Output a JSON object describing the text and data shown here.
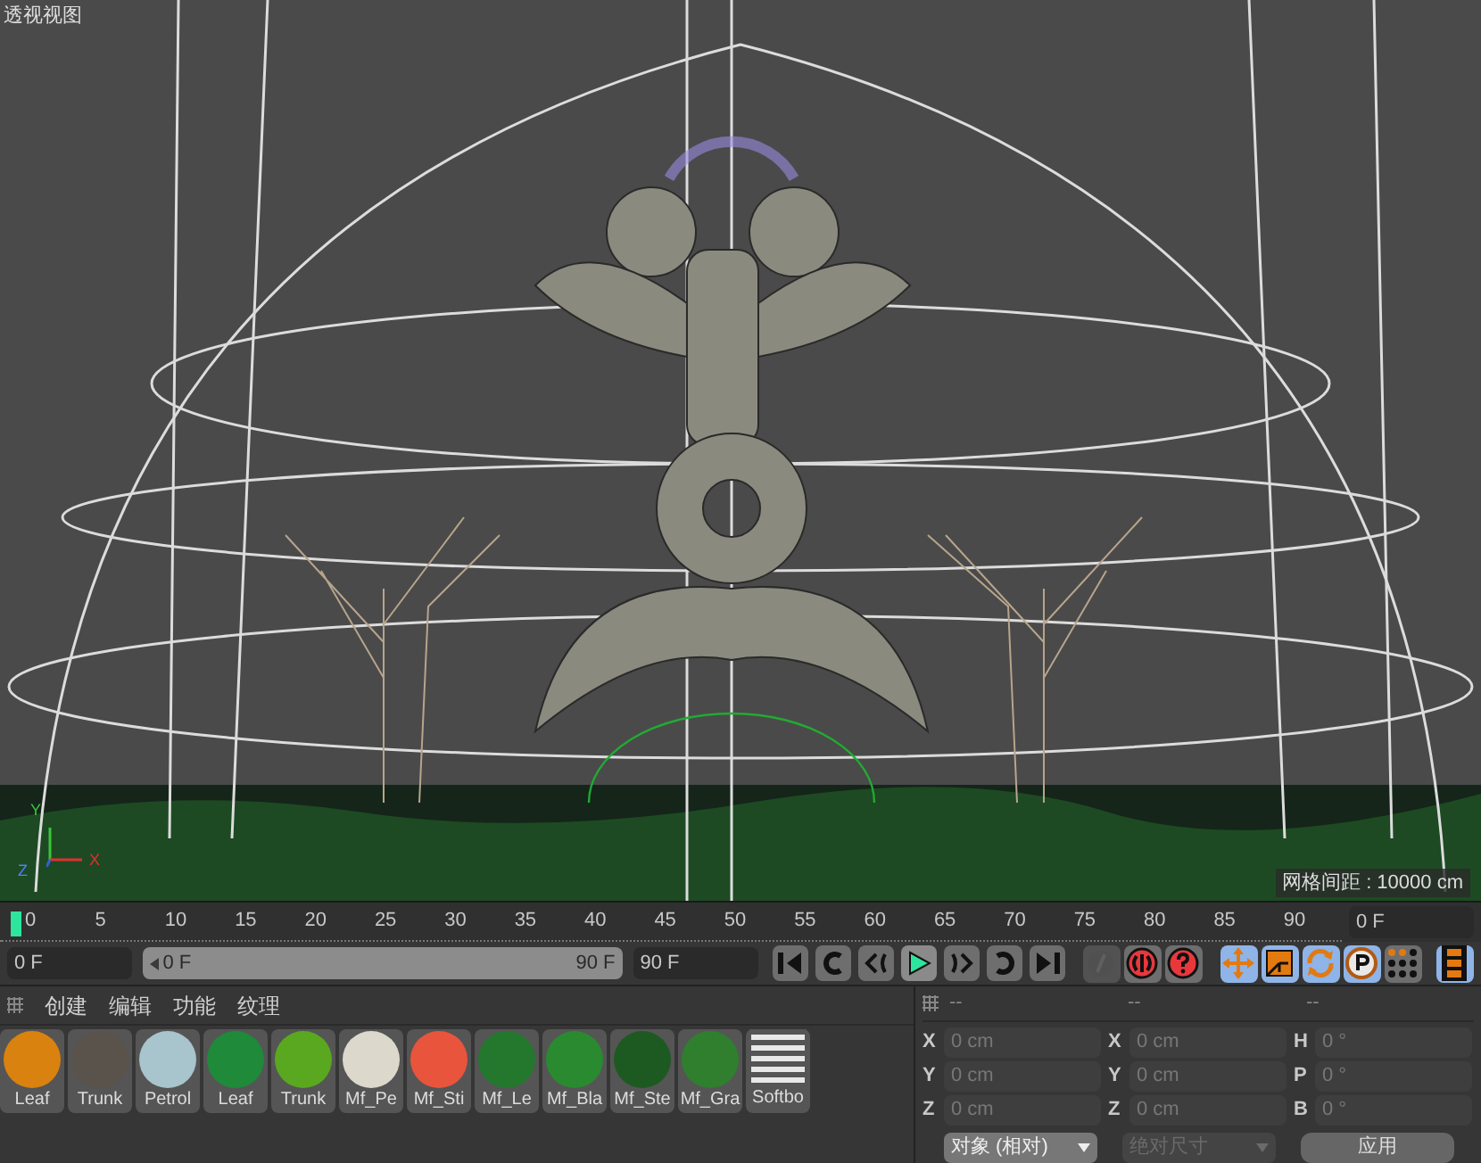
{
  "viewport": {
    "title": "透视视图",
    "grid_spacing": "网格间距 : 10000 cm",
    "axis_labels": [
      "Y",
      "X",
      "Z"
    ]
  },
  "timeline": {
    "ticks": [
      "0",
      "5",
      "10",
      "15",
      "20",
      "25",
      "30",
      "35",
      "40",
      "45",
      "50",
      "55",
      "60",
      "65",
      "70",
      "75",
      "80",
      "85",
      "90"
    ],
    "playhead": {
      "level": 0
    },
    "frame_field": "0 F"
  },
  "range": {
    "start_field": "0 F",
    "slider_start": "0 F",
    "slider_end": "90 F",
    "level": 1,
    "end_field": "90 F"
  },
  "transport": [
    {
      "kind": "first",
      "active": false
    },
    {
      "kind": "prev_key",
      "active": false
    },
    {
      "kind": "prev_frame",
      "active": false
    },
    {
      "kind": "play",
      "active": true
    },
    {
      "kind": "next_frame",
      "active": false
    },
    {
      "kind": "next_key",
      "active": false
    },
    {
      "kind": "last",
      "active": false
    }
  ],
  "record_buttons": [
    {
      "kind": "keyframe",
      "disabled": true
    },
    {
      "kind": "record",
      "disabled": false
    },
    {
      "kind": "help",
      "disabled": false
    }
  ],
  "mode_buttons": [
    {
      "kind": "move",
      "selected": true
    },
    {
      "kind": "scale",
      "selected": true
    },
    {
      "kind": "rotate",
      "selected": true
    },
    {
      "kind": "param",
      "selected": true
    },
    {
      "kind": "points",
      "selected": false
    },
    {
      "kind": "film",
      "selected": true
    }
  ],
  "material_menu": [
    "创建",
    "编辑",
    "功能",
    "纹理"
  ],
  "materials": [
    {
      "name": "Leaf",
      "color": "#d9820f"
    },
    {
      "name": "Trunk",
      "color": "#5a534c"
    },
    {
      "name": "Petrol",
      "color": "#a8c4cc"
    },
    {
      "name": "Leaf",
      "color": "#1f8a3a"
    },
    {
      "name": "Trunk",
      "color": "#5aa81f"
    },
    {
      "name": "Mf_Pe",
      "color": "#ddd8cc"
    },
    {
      "name": "Mf_Sti",
      "color": "#e8553c"
    },
    {
      "name": "Mf_Le",
      "color": "#23782e"
    },
    {
      "name": "Mf_Bla",
      "color": "#2a8a30"
    },
    {
      "name": "Mf_Ste",
      "color": "#1d5a22"
    },
    {
      "name": "Mf_Gra",
      "color": "#2f7f2f"
    },
    {
      "name": "Softbo",
      "color": "#e8e8e8"
    }
  ],
  "coordinates": {
    "headers": [
      "--",
      "--",
      "--"
    ],
    "rows": [
      [
        {
          "axis": "X",
          "value": "0 cm"
        },
        {
          "axis": "X",
          "value": "0 cm"
        },
        {
          "axis": "H",
          "value": "0 °"
        }
      ],
      [
        {
          "axis": "Y",
          "value": "0 cm"
        },
        {
          "axis": "Y",
          "value": "0 cm"
        },
        {
          "axis": "P",
          "value": "0 °"
        }
      ],
      [
        {
          "axis": "Z",
          "value": "0 cm"
        },
        {
          "axis": "Z",
          "value": "0 cm"
        },
        {
          "axis": "B",
          "value": "0 °"
        }
      ]
    ],
    "dropdowns": [
      {
        "label": "对象 (相对)",
        "disabled": false
      },
      {
        "label": "绝对尺寸",
        "disabled": true
      }
    ],
    "apply_button": "应用"
  }
}
